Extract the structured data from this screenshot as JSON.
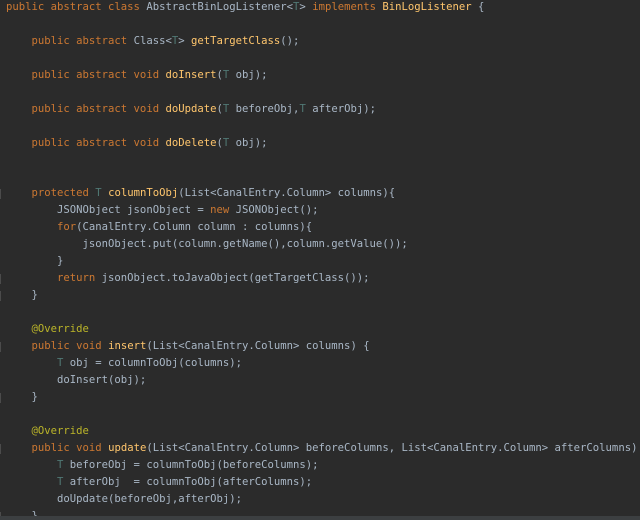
{
  "editor": {
    "background": "#2b2b2b",
    "colors": {
      "keyword": "#cc7832",
      "type_param": "#507874",
      "method": "#ffc66d",
      "annotation": "#bbb529",
      "text": "#a9b7c6"
    },
    "lines": [
      {
        "tokens": [
          {
            "t": "kw",
            "v": "public abstract class "
          },
          {
            "t": "tx",
            "v": "AbstractBinLogListener<"
          },
          {
            "t": "tp",
            "v": "T"
          },
          {
            "t": "tx",
            "v": "> "
          },
          {
            "t": "kw",
            "v": "implements "
          },
          {
            "t": "fn",
            "v": "BinLogListener"
          },
          {
            "t": "tx",
            "v": " {"
          }
        ]
      },
      {
        "tokens": []
      },
      {
        "tokens": [
          {
            "t": "kw",
            "v": "    public abstract "
          },
          {
            "t": "tx",
            "v": "Class<"
          },
          {
            "t": "tp",
            "v": "T"
          },
          {
            "t": "tx",
            "v": "> "
          },
          {
            "t": "fn",
            "v": "getTargetClass"
          },
          {
            "t": "tx",
            "v": "();"
          }
        ]
      },
      {
        "tokens": []
      },
      {
        "tokens": [
          {
            "t": "kw",
            "v": "    public abstract void "
          },
          {
            "t": "fn",
            "v": "doInsert"
          },
          {
            "t": "tx",
            "v": "("
          },
          {
            "t": "tp",
            "v": "T"
          },
          {
            "t": "tx",
            "v": " obj);"
          }
        ]
      },
      {
        "tokens": []
      },
      {
        "tokens": [
          {
            "t": "kw",
            "v": "    public abstract void "
          },
          {
            "t": "fn",
            "v": "doUpdate"
          },
          {
            "t": "tx",
            "v": "("
          },
          {
            "t": "tp",
            "v": "T"
          },
          {
            "t": "tx",
            "v": " beforeObj,"
          },
          {
            "t": "tp",
            "v": "T"
          },
          {
            "t": "tx",
            "v": " afterObj);"
          }
        ]
      },
      {
        "tokens": []
      },
      {
        "tokens": [
          {
            "t": "kw",
            "v": "    public abstract void "
          },
          {
            "t": "fn",
            "v": "doDelete"
          },
          {
            "t": "tx",
            "v": "("
          },
          {
            "t": "tp",
            "v": "T"
          },
          {
            "t": "tx",
            "v": " obj);"
          }
        ]
      },
      {
        "tokens": []
      },
      {
        "tokens": []
      },
      {
        "tokens": [
          {
            "t": "kw",
            "v": "    protected "
          },
          {
            "t": "tp",
            "v": "T "
          },
          {
            "t": "fn",
            "v": "columnToObj"
          },
          {
            "t": "tx",
            "v": "(List<CanalEntry.Column> columns){"
          }
        ]
      },
      {
        "tokens": [
          {
            "t": "tx",
            "v": "        JSONObject jsonObject = "
          },
          {
            "t": "kw",
            "v": "new "
          },
          {
            "t": "tx",
            "v": "JSONObject();"
          }
        ]
      },
      {
        "tokens": [
          {
            "t": "kw",
            "v": "        for"
          },
          {
            "t": "tx",
            "v": "(CanalEntry.Column column : columns){"
          }
        ]
      },
      {
        "tokens": [
          {
            "t": "tx",
            "v": "            jsonObject.put(column.getName(),column.getValue());"
          }
        ]
      },
      {
        "tokens": [
          {
            "t": "tx",
            "v": "        }"
          }
        ]
      },
      {
        "tokens": [
          {
            "t": "kw",
            "v": "        return "
          },
          {
            "t": "tx",
            "v": "jsonObject.toJavaObject(getTargetClass());"
          }
        ]
      },
      {
        "tokens": [
          {
            "t": "tx",
            "v": "    }"
          }
        ]
      },
      {
        "tokens": []
      },
      {
        "tokens": [
          {
            "t": "an",
            "v": "    @Override"
          }
        ]
      },
      {
        "tokens": [
          {
            "t": "kw",
            "v": "    public void "
          },
          {
            "t": "fn",
            "v": "insert"
          },
          {
            "t": "tx",
            "v": "(List<CanalEntry.Column> columns) {"
          }
        ]
      },
      {
        "tokens": [
          {
            "t": "tp",
            "v": "        T "
          },
          {
            "t": "tx",
            "v": "obj = columnToObj(columns);"
          }
        ]
      },
      {
        "tokens": [
          {
            "t": "tx",
            "v": "        doInsert(obj);"
          }
        ]
      },
      {
        "tokens": [
          {
            "t": "tx",
            "v": "    }"
          }
        ]
      },
      {
        "tokens": []
      },
      {
        "tokens": [
          {
            "t": "an",
            "v": "    @Override"
          }
        ]
      },
      {
        "tokens": [
          {
            "t": "kw",
            "v": "    public void "
          },
          {
            "t": "fn",
            "v": "update"
          },
          {
            "t": "tx",
            "v": "(List<CanalEntry.Column> beforeColumns, List<CanalEntry.Column> afterColumns) {"
          }
        ]
      },
      {
        "tokens": [
          {
            "t": "tp",
            "v": "        T "
          },
          {
            "t": "tx",
            "v": "beforeObj = columnToObj(beforeColumns);"
          }
        ]
      },
      {
        "tokens": [
          {
            "t": "tp",
            "v": "        T "
          },
          {
            "t": "tx",
            "v": "afterObj  = columnToObj(afterColumns);"
          }
        ]
      },
      {
        "tokens": [
          {
            "t": "tx",
            "v": "        doUpdate(beforeObj,afterObj);"
          }
        ]
      },
      {
        "tokens": [
          {
            "t": "tx",
            "v": "    }"
          }
        ]
      }
    ]
  }
}
